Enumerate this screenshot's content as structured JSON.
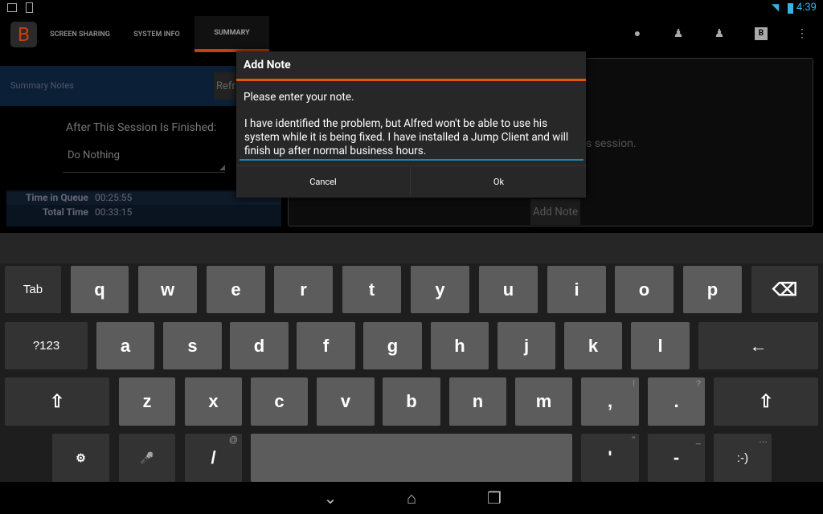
{
  "status_bar": {
    "time": "4:39",
    "icons": [
      "image-icon",
      "download-icon",
      "wifi-icon",
      "battery-icon"
    ]
  },
  "action_bar": {
    "app_logo": "B",
    "tabs": [
      {
        "label": "SCREEN SHARING"
      },
      {
        "label": "SYSTEM INFO"
      },
      {
        "label": "SUMMARY",
        "active": true
      }
    ],
    "icons": [
      "chat-icon",
      "add-user-icon",
      "user-icon",
      "b-icon",
      "overflow-icon"
    ],
    "accent": "#e2570f"
  },
  "left_panel": {
    "summary_notes_label": "Summary Notes",
    "refresh_label": "Refr",
    "after_session_label": "After This Session Is Finished:",
    "after_session_value": "Do Nothing",
    "stats": [
      {
        "label": "Time in Queue",
        "value": "00:25:55"
      },
      {
        "label": "Total Time",
        "value": "00:33:15"
      }
    ]
  },
  "right_panel": {
    "text_fragment": "s session.",
    "add_note_label": "Add Note"
  },
  "dialog": {
    "title": "Add Note",
    "prompt": "Please enter your note.",
    "note_value": "I have identified the problem, but Alfred won't be able to use his system while it is being fixed. I have installed a Jump Client and will finish up after normal business hours.",
    "cancel_label": "Cancel",
    "ok_label": "Ok"
  },
  "keyboard": {
    "rows": [
      [
        {
          "l": "Tab",
          "d": 1,
          "s": 1
        },
        {
          "l": "q"
        },
        {
          "l": "w"
        },
        {
          "l": "e"
        },
        {
          "l": "r"
        },
        {
          "l": "t"
        },
        {
          "l": "y"
        },
        {
          "l": "u"
        },
        {
          "l": "i"
        },
        {
          "l": "o"
        },
        {
          "l": "p"
        },
        {
          "l": "⌫",
          "d": 1,
          "n": "backspace"
        }
      ],
      [
        {
          "l": "?123",
          "d": 1,
          "s": 1
        },
        {
          "l": "a"
        },
        {
          "l": "s"
        },
        {
          "l": "d"
        },
        {
          "l": "f"
        },
        {
          "l": "g"
        },
        {
          "l": "h"
        },
        {
          "l": "j"
        },
        {
          "l": "k"
        },
        {
          "l": "l"
        },
        {
          "l": "←",
          "d": 1,
          "n": "enter"
        }
      ],
      [
        {
          "l": "⇧",
          "d": 1,
          "n": "shift"
        },
        {
          "l": "z"
        },
        {
          "l": "x"
        },
        {
          "l": "c"
        },
        {
          "l": "v"
        },
        {
          "l": "b"
        },
        {
          "l": "n"
        },
        {
          "l": "m"
        },
        {
          "l": ",",
          "sup": "!"
        },
        {
          "l": ".",
          "sup": "?"
        },
        {
          "l": "⇧",
          "d": 1,
          "n": "shift"
        }
      ],
      [
        {
          "l": "⚙",
          "d": 1,
          "n": "settings"
        },
        {
          "l": "🎤",
          "d": 1,
          "n": "mic"
        },
        {
          "l": "/",
          "d": 1,
          "sup": "@"
        },
        {
          "l": "",
          "n": "space"
        },
        {
          "l": "'",
          "d": 1,
          "sup": "\""
        },
        {
          "l": "-",
          "d": 1,
          "sup": "_"
        },
        {
          "l": ":-)",
          "d": 1,
          "s": 1,
          "sup": "…"
        }
      ]
    ]
  },
  "nav_bar": {
    "icons": [
      "back-icon",
      "home-icon",
      "recents-icon"
    ]
  }
}
